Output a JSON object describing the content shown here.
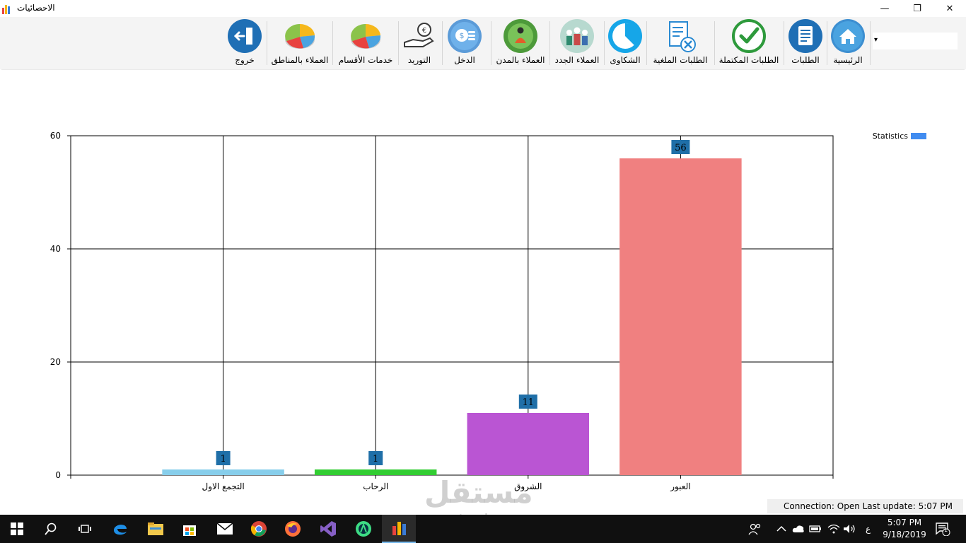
{
  "window": {
    "title": "الاحصائيات",
    "minimize_glyph": "—",
    "restore_glyph": "❐",
    "close_glyph": "✕"
  },
  "toolbar": {
    "combo_arrow": "▾",
    "buttons": [
      {
        "label": "الرئيسية",
        "icon": "home-icon"
      },
      {
        "label": "الطلبات",
        "icon": "document-icon"
      },
      {
        "label": "الطلبات المكتملة",
        "icon": "checkmark-icon"
      },
      {
        "label": "الطلبات الملغية",
        "icon": "cancelled-document-icon"
      },
      {
        "label": "الشكاوى",
        "icon": "pie-clock-icon"
      },
      {
        "label": "العملاء الجدد",
        "icon": "people-group-icon"
      },
      {
        "label": "العملاء بالمدن",
        "icon": "globe-person-icon"
      },
      {
        "label": "الدخل",
        "icon": "coins-icon"
      },
      {
        "label": "التوريد",
        "icon": "hand-money-icon"
      },
      {
        "label": "خدمات الأقسام",
        "icon": "pie-chart-icon"
      },
      {
        "label": "العملاء بالمناطق",
        "icon": "pie-chart-icon"
      },
      {
        "label": "خروج",
        "icon": "exit-door-icon"
      }
    ]
  },
  "chart_data": {
    "type": "bar",
    "categories": [
      "التجمع الاول",
      "الرحاب",
      "الشروق",
      "العبور"
    ],
    "values": [
      1,
      1,
      11,
      56
    ],
    "data_labels": [
      "1",
      "1",
      "11",
      "56"
    ],
    "bar_colors": [
      "#87ceeb",
      "#32cd32",
      "#ba55d3",
      "#f08080"
    ],
    "label_box_color": "#1f6fa8",
    "series": [
      {
        "name": "Statistics",
        "values": [
          1,
          1,
          11,
          56
        ],
        "legend_color": "#418cf0"
      }
    ],
    "ylim": [
      0,
      60
    ],
    "yticks": [
      "0",
      "20",
      "40",
      "60"
    ],
    "grid": true,
    "legend_position": "top-right"
  },
  "status": {
    "text": "Connection: Open Last update: 5:07 PM"
  },
  "watermark": {
    "arabic": "مستقل",
    "latin": "mostaql.com"
  },
  "taskbar": {
    "time": "5:07 PM",
    "date": "9/18/2019",
    "input_lang": "ع",
    "notification_count": "1",
    "pinned": [
      "start-icon",
      "search-icon",
      "task-view-icon",
      "edge-icon",
      "file-explorer-icon",
      "store-icon",
      "mail-icon",
      "chrome-icon",
      "firefox-icon",
      "visual-studio-icon",
      "android-studio-icon",
      "stats-app-icon"
    ]
  },
  "colors": {
    "accent": "#1f6fa8",
    "taskbar": "#101010"
  }
}
